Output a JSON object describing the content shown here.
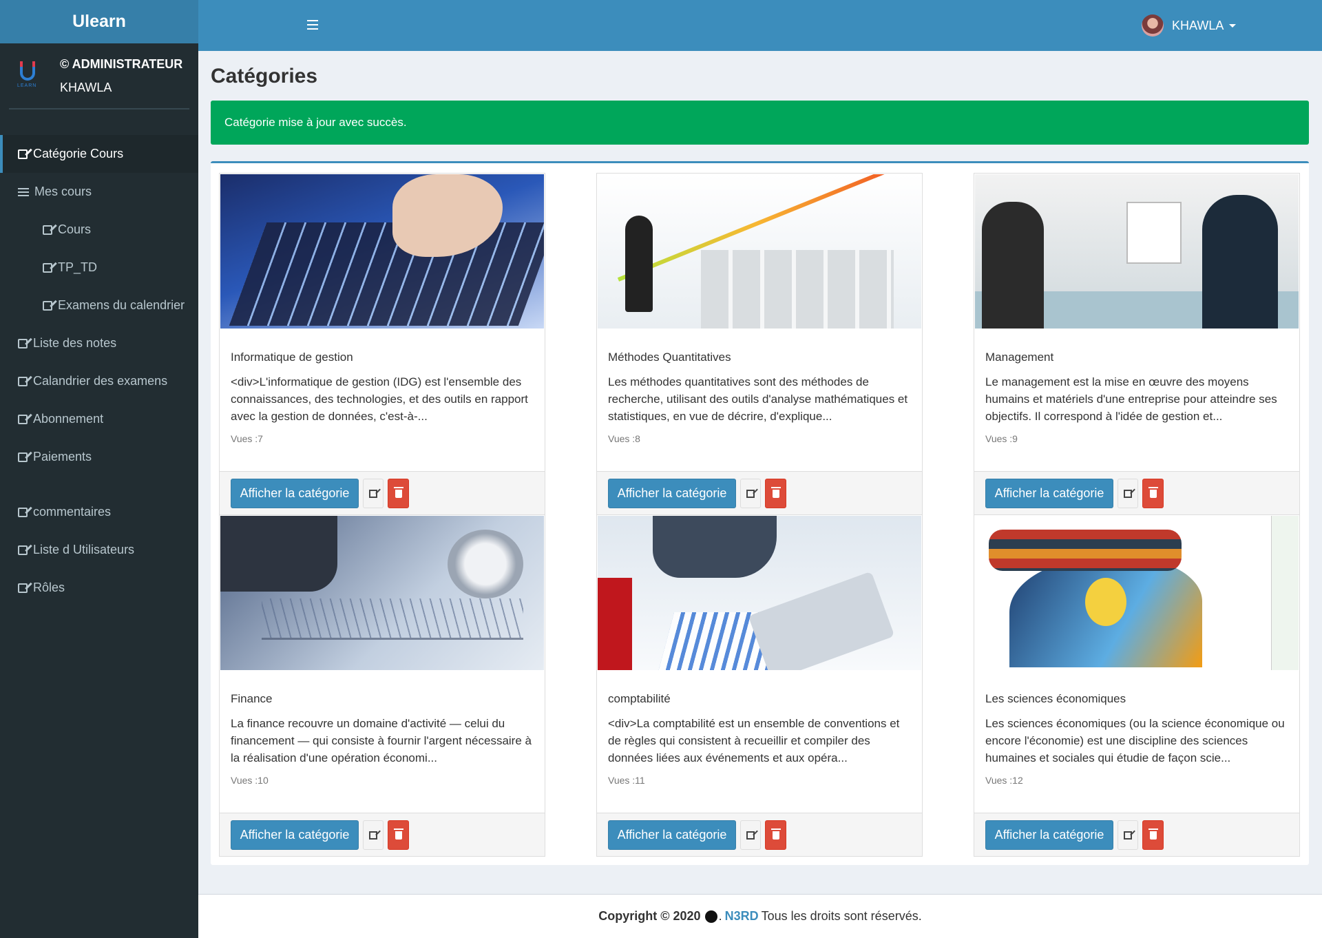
{
  "app": {
    "brand": "Ulearn",
    "logo_text": "LEARN"
  },
  "user_panel": {
    "role": "© ADMINISTRATEUR",
    "name": "KHAWLA"
  },
  "sidebar": {
    "items": [
      {
        "label": "Catégorie Cours",
        "icon": "edit-icon"
      },
      {
        "label": "Mes cours",
        "icon": "list-icon"
      },
      {
        "label": "Cours",
        "icon": "edit-icon"
      },
      {
        "label": "TP_TD",
        "icon": "edit-icon"
      },
      {
        "label": "Examens du calendrier",
        "icon": "edit-icon"
      },
      {
        "label": "Liste des notes",
        "icon": "edit-icon"
      },
      {
        "label": "Calandrier des examens",
        "icon": "edit-icon"
      },
      {
        "label": "Abonnement",
        "icon": "edit-icon"
      },
      {
        "label": "Paiements",
        "icon": "edit-icon"
      },
      {
        "label": "commentaires",
        "icon": "edit-icon"
      },
      {
        "label": "Liste d Utilisateurs",
        "icon": "edit-icon"
      },
      {
        "label": "Rôles",
        "icon": "edit-icon"
      }
    ]
  },
  "header": {
    "user_name": "KHAWLA"
  },
  "page": {
    "title": "Catégories",
    "alert": "Catégorie mise à jour avec succès."
  },
  "cards": [
    {
      "title": "Informatique de gestion",
      "description": "<div>L'informatique de gestion (IDG) est l'ensemble des connaissances, des technologies, et des outils en rapport avec la gestion de données, c'est-à-...",
      "views": "Vues :7",
      "button": "Afficher la catégorie"
    },
    {
      "title": "Méthodes Quantitatives",
      "description": "Les méthodes quantitatives sont des méthodes de recherche, utilisant des outils d'analyse mathématiques et statistiques, en vue de décrire, d'explique...",
      "views": "Vues :8",
      "button": "Afficher la catégorie"
    },
    {
      "title": "Management",
      "description": "Le management est la mise en œuvre des moyens humains et matériels d'une entreprise pour atteindre ses objectifs. Il correspond à l'idée de gestion et...",
      "views": "Vues :9",
      "button": "Afficher la catégorie"
    },
    {
      "title": "Finance",
      "description": "La finance recouvre un domaine d'activité — celui du financement — qui consiste à fournir l'argent nécessaire à la réalisation d'une opération économi...",
      "views": "Vues :10",
      "button": "Afficher la catégorie"
    },
    {
      "title": "comptabilité",
      "description": "<div>La comptabilité est un ensemble de conventions et de règles qui consistent à recueillir et compiler des données liées aux événements et aux opéra...",
      "views": "Vues :11",
      "button": "Afficher la catégorie"
    },
    {
      "title": "Les sciences économiques",
      "description": "Les sciences économiques (ou la science économique ou encore l'économie) est une discipline des sciences humaines et sociales qui étudie de façon scie...",
      "views": "Vues :12",
      "button": "Afficher la catégorie"
    }
  ],
  "footer": {
    "copyright": "Copyright © 2020",
    "brand": "N3RD",
    "rights": "Tous les droits sont réservés."
  },
  "colors": {
    "primary": "#3c8dbc",
    "header": "#3c8dbc",
    "brand_bar": "#367fa9",
    "sidebar": "#222d32",
    "success": "#00a65a",
    "danger": "#dd4b39"
  }
}
